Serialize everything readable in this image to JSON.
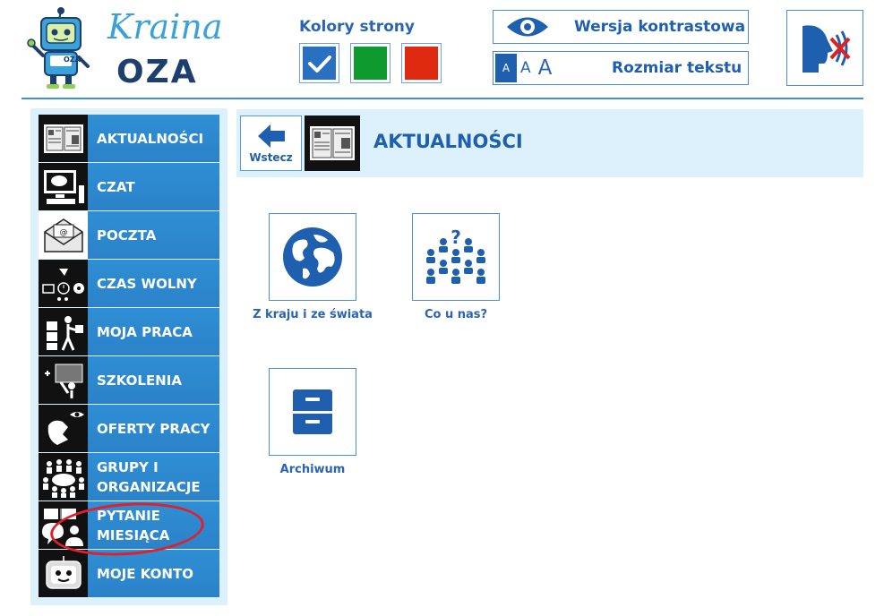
{
  "logo": {
    "word_top": "Kraina",
    "word_bottom": "OZA",
    "badge": "OZA",
    "colors": {
      "script": "#3aa2d9",
      "bold": "#1c3f6e"
    }
  },
  "header": {
    "colors_title": "Kolory strony",
    "swatches": [
      {
        "color": "#2a70c0",
        "selected": true
      },
      {
        "color": "#0e9a2e",
        "selected": false
      },
      {
        "color": "#dd2a10",
        "selected": false
      }
    ],
    "contrast_label": "Wersja kontrastowa",
    "textsize_letters": [
      "A",
      "A",
      "A"
    ],
    "textsize_label": "Rozmiar tekstu",
    "icons": {
      "contrast": "eye-icon",
      "speech": "speech-off-icon"
    }
  },
  "sidebar": {
    "items": [
      {
        "label": "AKTUALNOŚCI",
        "icon": "newspaper-icon"
      },
      {
        "label": "CZAT",
        "icon": "chat-computer-icon"
      },
      {
        "label": "POCZTA",
        "icon": "envelope-icon"
      },
      {
        "label": "CZAS WOLNY",
        "icon": "leisure-icon"
      },
      {
        "label": "MOJA PRACA",
        "icon": "worker-icon"
      },
      {
        "label": "SZKOLENIA",
        "icon": "training-icon"
      },
      {
        "label": "OFERTY PRACY",
        "icon": "job-offers-icon"
      },
      {
        "label": "GRUPY I ORGANIZACJE",
        "icon": "groups-icon"
      },
      {
        "label": "PYTANIE MIESIĄCA",
        "icon": "question-month-icon"
      },
      {
        "label": "MOJE KONTO",
        "icon": "robot-account-icon"
      }
    ],
    "highlighted_index": 8,
    "colors": {
      "item_bg": "#2b88ce",
      "panel_bg": "#dcf1fb",
      "annotation": "#e0202a"
    }
  },
  "main": {
    "back_label": "Wstecz",
    "title": "AKTUALNOŚCI",
    "tiles": [
      {
        "label": "Z kraju i ze świata",
        "icon": "globe-icon"
      },
      {
        "label": "Co u nas?",
        "icon": "people-question-icon"
      },
      {
        "label": "Archiwum",
        "icon": "cabinet-icon"
      }
    ]
  }
}
